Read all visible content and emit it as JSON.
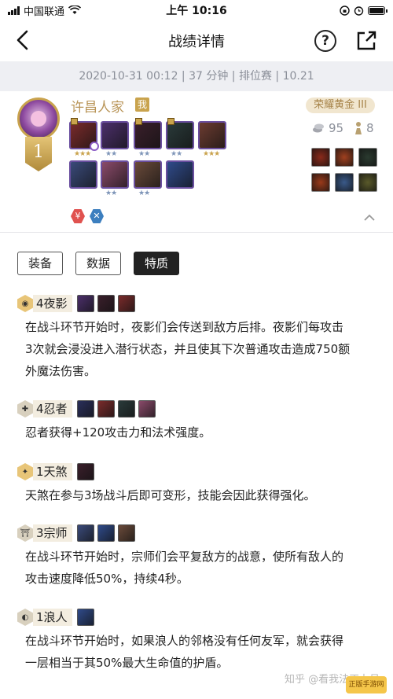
{
  "status_bar": {
    "carrier": "中国联通",
    "time": "上午 10:16"
  },
  "nav": {
    "title": "战绩详情",
    "help_label": "?"
  },
  "match_info": "2020-10-31 00:12 | 37 分钟 | 排位赛 | 10.21",
  "player": {
    "name": "许昌人家",
    "me_badge": "我",
    "placement": "1",
    "rank_tier": "荣耀黄金 III",
    "coins": "95",
    "level": "8"
  },
  "units": [
    {
      "icon": "unit-portrait-1",
      "stars": "★★★",
      "star_color": "#c9a34d",
      "items": 1,
      "color": "#7a2b2b"
    },
    {
      "icon": "unit-portrait-2",
      "stars": "★★",
      "star_color": "#7e95b8",
      "items": 0,
      "color": "#4b2f6a"
    },
    {
      "icon": "unit-portrait-3",
      "stars": "★★",
      "star_color": "#7e95b8",
      "items": 1,
      "color": "#3a1f2b"
    },
    {
      "icon": "unit-portrait-4",
      "stars": "★★",
      "star_color": "#7e95b8",
      "items": 1,
      "color": "#2a3a3a"
    },
    {
      "icon": "unit-portrait-5",
      "stars": "★★★",
      "star_color": "#c9a34d",
      "items": 0,
      "color": "#6b3b30"
    },
    {
      "icon": "unit-portrait-6",
      "stars": "",
      "star_color": "#7e95b8",
      "items": 0,
      "color": "#3a4a7a"
    },
    {
      "icon": "unit-portrait-7",
      "stars": "★★",
      "star_color": "#7e95b8",
      "items": 0,
      "color": "#8a4a6a"
    },
    {
      "icon": "unit-portrait-8",
      "stars": "★★",
      "star_color": "#7e95b8",
      "items": 0,
      "color": "#6a4a3a"
    },
    {
      "icon": "unit-portrait-9",
      "stars": "",
      "star_color": "#7e95b8",
      "items": 0,
      "color": "#2f4a8a"
    },
    {
      "icon": "unit-portrait-10",
      "stars": "",
      "star_color": "#7e95b8",
      "items": 0,
      "color": "#2a2f5a"
    }
  ],
  "items": [
    {
      "icon": "item-1",
      "color": "#8a2a1a"
    },
    {
      "icon": "item-2",
      "color": "#a0401f"
    },
    {
      "icon": "item-3",
      "color": "#2a3a2f"
    },
    {
      "icon": "item-4",
      "color": "#9a3a1a"
    },
    {
      "icon": "item-5",
      "color": "#3a5a8a"
    },
    {
      "icon": "item-6",
      "color": "#5a5a2a"
    },
    {
      "icon": "item-7",
      "color": "#2a2a2a"
    }
  ],
  "augments": [
    {
      "icon": "yen-icon",
      "glyph": "¥",
      "color": "#e0524f"
    },
    {
      "icon": "cross-icon",
      "glyph": "✕",
      "color": "#3d7fbf"
    }
  ],
  "tabs": [
    "装备",
    "数据",
    "特质"
  ],
  "active_tab": 2,
  "traits": [
    {
      "icon": "eye-icon",
      "glyph": "◉",
      "hex_color": "#e8c578",
      "name": "4夜影",
      "units": 3,
      "unit_colors": [
        "#4b2f6a",
        "#3a1f2b",
        "#7a2b2b"
      ],
      "lines": [
        "在战斗环节开始时，夜影们会传送到敌方后排。夜影们每攻击",
        "3次就会浸没进入潜行状态，并且使其下次普通攻击造成750额",
        "外魔法伤害。"
      ]
    },
    {
      "icon": "shuriken-icon",
      "glyph": "✚",
      "hex_color": "#d8d0be",
      "name": "4忍者",
      "units": 4,
      "unit_colors": [
        "#2a2f5a",
        "#7a2b2b",
        "#2a3a3a",
        "#8a4a6a"
      ],
      "lines": [
        "忍者获得+120攻击力和法术强度。"
      ]
    },
    {
      "icon": "demon-icon",
      "glyph": "✦",
      "hex_color": "#e8c578",
      "name": "1天煞",
      "units": 1,
      "unit_colors": [
        "#3a1f2b"
      ],
      "lines": [
        "天煞在参与3场战斗后即可变形，技能会因此获得强化。"
      ]
    },
    {
      "icon": "torii-icon",
      "glyph": "⛩",
      "hex_color": "#d8d0be",
      "name": "3宗师",
      "units": 3,
      "unit_colors": [
        "#3a4a7a",
        "#2f4a8a",
        "#6a4a3a"
      ],
      "lines": [
        "在战斗环节开始时，宗师们会平复敌方的战意，使所有敌人的",
        "攻击速度降低50%，持续4秒。"
      ]
    },
    {
      "icon": "ronin-icon",
      "glyph": "◐",
      "hex_color": "#d8d0be",
      "name": "1浪人",
      "units": 1,
      "unit_colors": [
        "#2f4a8a"
      ],
      "lines": [
        "在战斗环节开始时，如果浪人的邻格没有任何友军，就会获得",
        "一层相当于其50%最大生命值的护盾。"
      ]
    }
  ],
  "watermark": "知乎 @看我法正力号",
  "watermark_badge": "正版手游网"
}
